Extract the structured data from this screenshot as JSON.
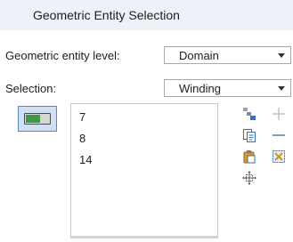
{
  "panel": {
    "title": "Geometric Entity Selection"
  },
  "fields": {
    "entity_level_label": "Geometric entity level:",
    "entity_level_value": "Domain",
    "selection_label": "Selection:",
    "selection_value": "Winding"
  },
  "selection_list": {
    "items": [
      "7",
      "8",
      "14"
    ]
  },
  "icons": {
    "toggle": "active-selection-toggle-icon",
    "tools": [
      "select-by-color-icon",
      "paste-selection-icon",
      "clipboard-icon",
      "zoom-to-selection-icon",
      "add-icon",
      "remove-icon",
      "clear-selection-icon"
    ]
  },
  "colors": {
    "header_bg": "#eef1f7",
    "toggle_active": "#3a9b46",
    "toggle_border": "#5b87c5"
  }
}
